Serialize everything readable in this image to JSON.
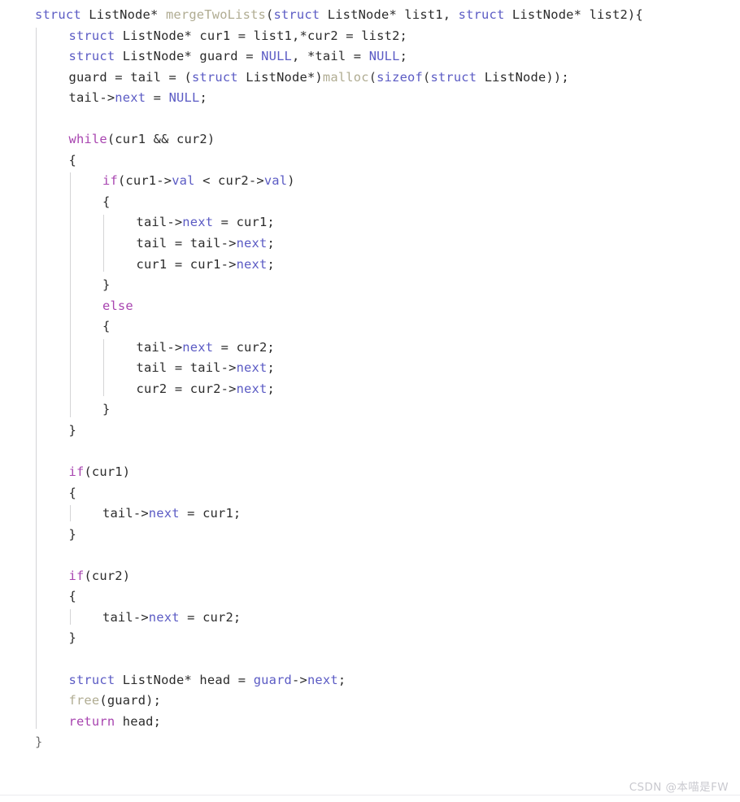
{
  "editor": {
    "language": "C",
    "background": "#ffffff",
    "font_size_px": 15.4,
    "line_height_px": 25.55
  },
  "colors": {
    "keyword": "#5b5bc4",
    "control": "#a845b0",
    "function": "#b0ac92",
    "member": "#5b5bc4",
    "plain": "#2b2b2b",
    "guide": "#d4d4d6",
    "watermark": "#c9c9cf"
  },
  "code": {
    "lines": [
      {
        "n": 1,
        "indent": 0,
        "tokens": [
          {
            "t": "struct",
            "c": "kw"
          },
          {
            "t": " ",
            "c": "plain"
          },
          {
            "t": "ListNode*",
            "c": "plain"
          },
          {
            "t": " ",
            "c": "plain"
          },
          {
            "t": "mergeTwoLists",
            "c": "fn"
          },
          {
            "t": "(",
            "c": "punc"
          },
          {
            "t": "struct",
            "c": "kw"
          },
          {
            "t": " ListNode* list1, ",
            "c": "plain"
          },
          {
            "t": "struct",
            "c": "kw"
          },
          {
            "t": " ListNode* list2)",
            "c": "plain"
          },
          {
            "t": "{",
            "c": "brace"
          }
        ]
      },
      {
        "n": 2,
        "indent": 1,
        "tokens": [
          {
            "t": "struct",
            "c": "kw"
          },
          {
            "t": " ListNode* cur1 = list1,*cur2 = list2;",
            "c": "plain"
          }
        ]
      },
      {
        "n": 3,
        "indent": 1,
        "tokens": [
          {
            "t": "struct",
            "c": "kw"
          },
          {
            "t": " ListNode* guard = ",
            "c": "plain"
          },
          {
            "t": "NULL",
            "c": "kw"
          },
          {
            "t": ", *tail = ",
            "c": "plain"
          },
          {
            "t": "NULL",
            "c": "kw"
          },
          {
            "t": ";",
            "c": "plain"
          }
        ]
      },
      {
        "n": 4,
        "indent": 1,
        "tokens": [
          {
            "t": "guard = tail = (",
            "c": "plain"
          },
          {
            "t": "struct",
            "c": "kw"
          },
          {
            "t": " ListNode*)",
            "c": "plain"
          },
          {
            "t": "malloc",
            "c": "fn"
          },
          {
            "t": "(",
            "c": "punc"
          },
          {
            "t": "sizeof",
            "c": "kw"
          },
          {
            "t": "(",
            "c": "punc"
          },
          {
            "t": "struct",
            "c": "kw"
          },
          {
            "t": " ListNode));",
            "c": "plain"
          }
        ]
      },
      {
        "n": 5,
        "indent": 1,
        "tokens": [
          {
            "t": "tail->",
            "c": "plain"
          },
          {
            "t": "next",
            "c": "member"
          },
          {
            "t": " = ",
            "c": "plain"
          },
          {
            "t": "NULL",
            "c": "kw"
          },
          {
            "t": ";",
            "c": "plain"
          }
        ]
      },
      {
        "n": 6,
        "indent": 1,
        "tokens": []
      },
      {
        "n": 7,
        "indent": 1,
        "tokens": [
          {
            "t": "while",
            "c": "ctrl"
          },
          {
            "t": "(cur1 && cur2)",
            "c": "plain"
          }
        ]
      },
      {
        "n": 8,
        "indent": 1,
        "tokens": [
          {
            "t": "{",
            "c": "brace"
          }
        ]
      },
      {
        "n": 9,
        "indent": 2,
        "tokens": [
          {
            "t": "if",
            "c": "ctrl"
          },
          {
            "t": "(cur1->",
            "c": "plain"
          },
          {
            "t": "val",
            "c": "member"
          },
          {
            "t": " < cur2->",
            "c": "plain"
          },
          {
            "t": "val",
            "c": "member"
          },
          {
            "t": ")",
            "c": "plain"
          }
        ]
      },
      {
        "n": 10,
        "indent": 2,
        "tokens": [
          {
            "t": "{",
            "c": "brace"
          }
        ]
      },
      {
        "n": 11,
        "indent": 3,
        "tokens": [
          {
            "t": "tail->",
            "c": "plain"
          },
          {
            "t": "next",
            "c": "member"
          },
          {
            "t": " = cur1;",
            "c": "plain"
          }
        ]
      },
      {
        "n": 12,
        "indent": 3,
        "tokens": [
          {
            "t": "tail = tail->",
            "c": "plain"
          },
          {
            "t": "next",
            "c": "member"
          },
          {
            "t": ";",
            "c": "plain"
          }
        ]
      },
      {
        "n": 13,
        "indent": 3,
        "tokens": [
          {
            "t": "cur1 = cur1->",
            "c": "plain"
          },
          {
            "t": "next",
            "c": "member"
          },
          {
            "t": ";",
            "c": "plain"
          }
        ]
      },
      {
        "n": 14,
        "indent": 2,
        "tokens": [
          {
            "t": "}",
            "c": "brace"
          }
        ]
      },
      {
        "n": 15,
        "indent": 2,
        "tokens": [
          {
            "t": "else",
            "c": "ctrl"
          }
        ]
      },
      {
        "n": 16,
        "indent": 2,
        "tokens": [
          {
            "t": "{",
            "c": "brace"
          }
        ]
      },
      {
        "n": 17,
        "indent": 3,
        "tokens": [
          {
            "t": "tail->",
            "c": "plain"
          },
          {
            "t": "next",
            "c": "member"
          },
          {
            "t": " = cur2;",
            "c": "plain"
          }
        ]
      },
      {
        "n": 18,
        "indent": 3,
        "tokens": [
          {
            "t": "tail = tail->",
            "c": "plain"
          },
          {
            "t": "next",
            "c": "member"
          },
          {
            "t": ";",
            "c": "plain"
          }
        ]
      },
      {
        "n": 19,
        "indent": 3,
        "tokens": [
          {
            "t": "cur2 = cur2->",
            "c": "plain"
          },
          {
            "t": "next",
            "c": "member"
          },
          {
            "t": ";",
            "c": "plain"
          }
        ]
      },
      {
        "n": 20,
        "indent": 2,
        "tokens": [
          {
            "t": "}",
            "c": "brace"
          }
        ]
      },
      {
        "n": 21,
        "indent": 1,
        "tokens": [
          {
            "t": "}",
            "c": "brace"
          }
        ]
      },
      {
        "n": 22,
        "indent": 1,
        "tokens": []
      },
      {
        "n": 23,
        "indent": 1,
        "tokens": [
          {
            "t": "if",
            "c": "ctrl"
          },
          {
            "t": "(cur1)",
            "c": "plain"
          }
        ]
      },
      {
        "n": 24,
        "indent": 1,
        "tokens": [
          {
            "t": "{",
            "c": "brace"
          }
        ]
      },
      {
        "n": 25,
        "indent": 2,
        "tokens": [
          {
            "t": "tail->",
            "c": "plain"
          },
          {
            "t": "next",
            "c": "member"
          },
          {
            "t": " = cur1;",
            "c": "plain"
          }
        ]
      },
      {
        "n": 26,
        "indent": 1,
        "tokens": [
          {
            "t": "}",
            "c": "brace"
          }
        ]
      },
      {
        "n": 27,
        "indent": 1,
        "tokens": []
      },
      {
        "n": 28,
        "indent": 1,
        "tokens": [
          {
            "t": "if",
            "c": "ctrl"
          },
          {
            "t": "(cur2)",
            "c": "plain"
          }
        ]
      },
      {
        "n": 29,
        "indent": 1,
        "tokens": [
          {
            "t": "{",
            "c": "brace"
          }
        ]
      },
      {
        "n": 30,
        "indent": 2,
        "tokens": [
          {
            "t": "tail->",
            "c": "plain"
          },
          {
            "t": "next",
            "c": "member"
          },
          {
            "t": " = cur2;",
            "c": "plain"
          }
        ]
      },
      {
        "n": 31,
        "indent": 1,
        "tokens": [
          {
            "t": "}",
            "c": "brace"
          }
        ]
      },
      {
        "n": 32,
        "indent": 1,
        "tokens": []
      },
      {
        "n": 33,
        "indent": 1,
        "tokens": [
          {
            "t": "struct",
            "c": "kw"
          },
          {
            "t": " ListNode* head = ",
            "c": "plain"
          },
          {
            "t": "guard",
            "c": "member"
          },
          {
            "t": "->",
            "c": "plain"
          },
          {
            "t": "next",
            "c": "member"
          },
          {
            "t": ";",
            "c": "plain"
          }
        ]
      },
      {
        "n": 34,
        "indent": 1,
        "tokens": [
          {
            "t": "free",
            "c": "fn"
          },
          {
            "t": "(guard);",
            "c": "plain"
          }
        ]
      },
      {
        "n": 35,
        "indent": 1,
        "tokens": [
          {
            "t": "return",
            "c": "ctrl"
          },
          {
            "t": " head;",
            "c": "plain"
          }
        ]
      },
      {
        "n": 36,
        "indent": 0,
        "tokens": [
          {
            "t": "}",
            "c": "faint"
          }
        ]
      }
    ]
  },
  "watermark": {
    "text": "CSDN @本喵是FW"
  }
}
